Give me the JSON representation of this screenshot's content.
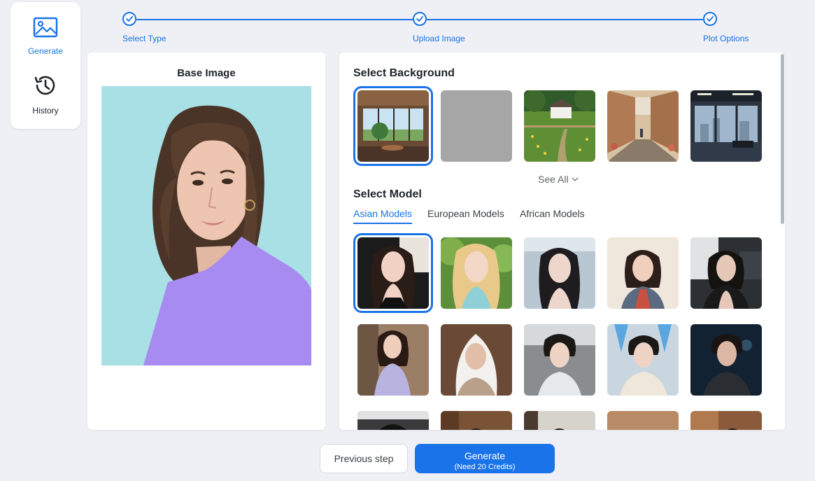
{
  "nav": {
    "items": [
      {
        "label": "Generate",
        "icon": "image-icon",
        "active": true
      },
      {
        "label": "History",
        "icon": "history-icon",
        "active": false
      }
    ]
  },
  "stepper": {
    "steps": [
      {
        "label": "Select Type",
        "done": true
      },
      {
        "label": "Upload Image",
        "done": true
      },
      {
        "label": "Plot Options",
        "done": true
      }
    ]
  },
  "base_image": {
    "title": "Base Image"
  },
  "background": {
    "title": "Select Background",
    "see_all": "See All",
    "selected_index": 0,
    "options": [
      "cafe-interior",
      "plain-gray",
      "countryside-field",
      "street-shops",
      "gym-city-view"
    ]
  },
  "model": {
    "title": "Select Model",
    "tabs": [
      "Asian Models",
      "European Models",
      "African Models"
    ],
    "active_tab": 0,
    "selected_index": 0
  },
  "footer": {
    "prev_label": "Previous step",
    "generate_label": "Generate",
    "generate_sub": "(Need 20 Credits)"
  },
  "colors": {
    "accent": "#1a73e8",
    "background": "#eef0f5",
    "shirt": "#a78bf0",
    "base_bg": "#a9e0e5"
  }
}
